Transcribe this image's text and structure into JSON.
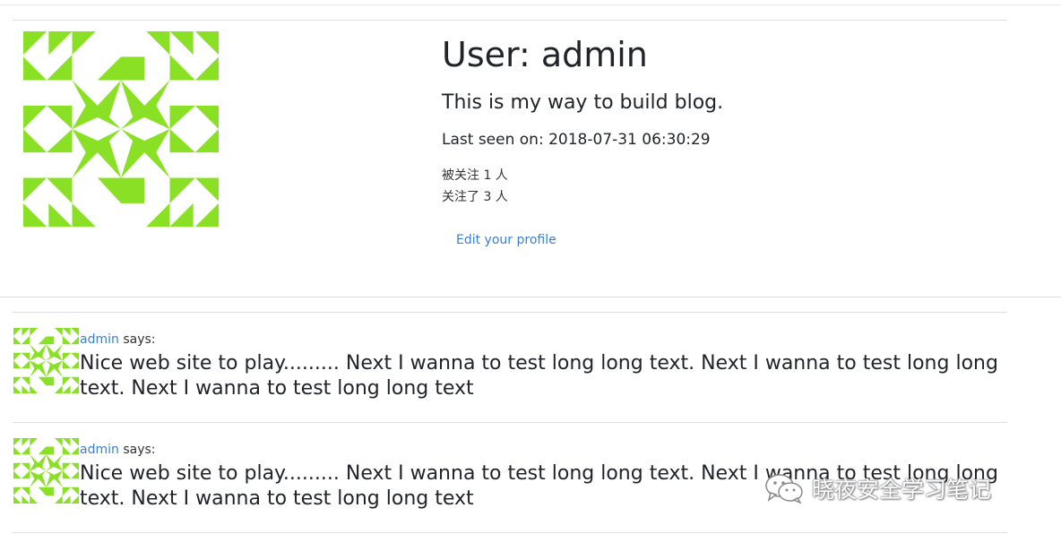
{
  "profile": {
    "title": "User: admin",
    "about": "This is my way to build blog.",
    "last_seen": "Last seen on: 2018-07-31 06:30:29",
    "followers": "被关注 1 人",
    "following": "关注了 3 人",
    "edit_link": "Edit your profile",
    "avatar_color": "#8ae025"
  },
  "posts": [
    {
      "author": "admin",
      "says": " says:",
      "body": "Nice web site to play......... Next I wanna to test long long text. Next I wanna to test long long text. Next I wanna to test long long text"
    },
    {
      "author": "admin",
      "says": " says:",
      "body": "Nice web site to play......... Next I wanna to test long long text. Next I wanna to test long long text. Next I wanna to test long long text"
    }
  ],
  "watermark": {
    "text": "晓夜安全学习笔记",
    "icon": "wechat-icon"
  },
  "colors": {
    "link": "#3a7fd5",
    "avatar": "#8ae025"
  }
}
